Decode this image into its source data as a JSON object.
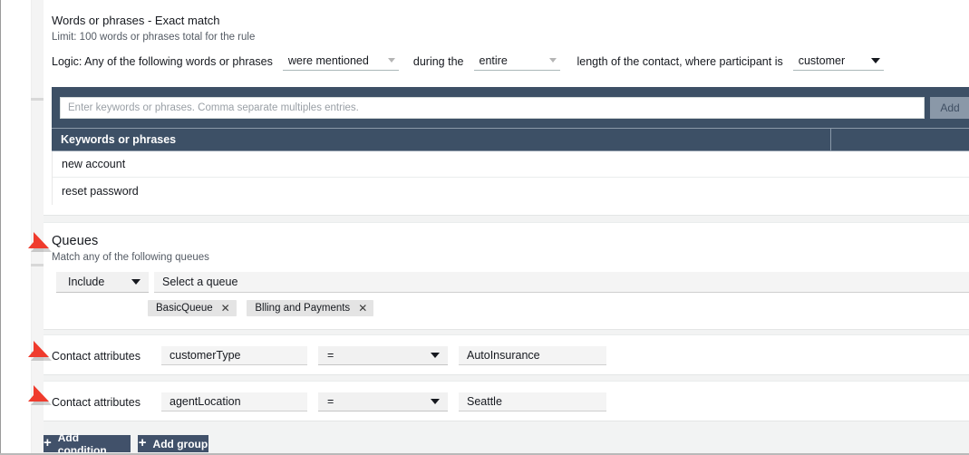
{
  "words_section": {
    "title": "Words or phrases - Exact match",
    "subtitle": "Limit: 100 words or phrases total for the rule",
    "logic_prefix": "Logic: Any of the following words or phrases",
    "match_select": "were mentioned",
    "during_label": "during the",
    "duration_select": "entire",
    "length_label": "length of the contact, where participant is",
    "participant_select": "customer",
    "keyword_placeholder": "Enter keywords or phrases. Comma separate multiples entries.",
    "add_button": "Add",
    "table_header": "Keywords or phrases",
    "rows": [
      "new account",
      "reset password"
    ]
  },
  "queues_section": {
    "title": "Queues",
    "subtitle": "Match any of the following queues",
    "include_select": "Include",
    "queue_placeholder": "Select a queue",
    "tags": [
      {
        "label": "BasicQueue",
        "remove": "✕"
      },
      {
        "label": "Blling and Payments",
        "remove": "✕"
      }
    ]
  },
  "attribute_rows": [
    {
      "label": "Contact attributes",
      "key": "customerType",
      "operator": "=",
      "value": "AutoInsurance"
    },
    {
      "label": "Contact attributes",
      "key": "agentLocation",
      "operator": "=",
      "value": "Seattle"
    }
  ],
  "footer": {
    "add_condition": "Add condition",
    "add_group": "Add group",
    "plus": "+"
  },
  "colors": {
    "panel_navy": "#3d5066",
    "button_navy": "#41516a",
    "arrow_red": "#ef3b2d",
    "page_bg": "#f2f3f3"
  }
}
